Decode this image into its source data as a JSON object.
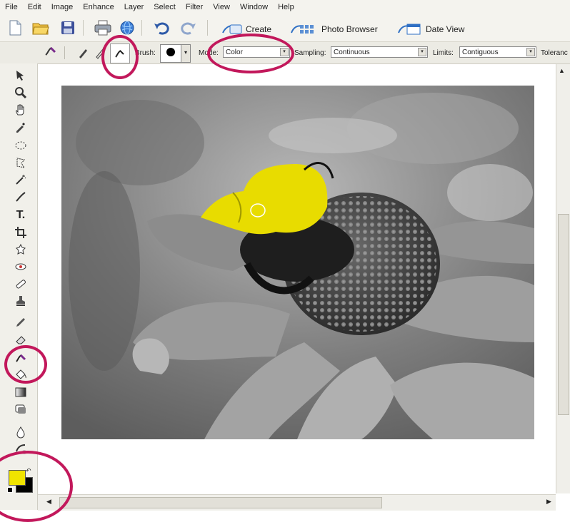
{
  "menu": [
    "File",
    "Edit",
    "Image",
    "Enhance",
    "Layer",
    "Select",
    "Filter",
    "View",
    "Window",
    "Help"
  ],
  "toolbar": {
    "create_label": "Create",
    "photo_browser_label": "Photo Browser",
    "date_view_label": "Date View"
  },
  "options": {
    "brush_label": "Brush:",
    "mode_label": "Mode:",
    "mode_value": "Color",
    "sampling_label": "Sampling:",
    "sampling_value": "Continuous",
    "limits_label": "Limits:",
    "limits_value": "Contiguous",
    "tolerance_label": "Toleranc"
  },
  "tools": [
    "move-tool-icon",
    "zoom-tool-icon",
    "hand-tool-icon",
    "eyedropper-tool-icon",
    "marquee-tool-icon",
    "lasso-tool-icon",
    "magic-wand-tool-icon",
    "selection-brush-tool-icon",
    "type-tool-icon",
    "crop-tool-icon",
    "cookie-cutter-tool-icon",
    "red-eye-tool-icon",
    "healing-brush-tool-icon",
    "clone-stamp-tool-icon",
    "pencil-tool-icon",
    "eraser-tool-icon",
    "color-replacement-tool-icon",
    "paint-bucket-tool-icon",
    "gradient-tool-icon",
    "shape-tool-icon",
    "blur-tool-icon",
    "sponge-tool-icon"
  ],
  "colors": {
    "foreground": "#f0e400",
    "background": "#000000",
    "annotation": "#c2185b",
    "highlight_yellow": "#e8dc00"
  }
}
